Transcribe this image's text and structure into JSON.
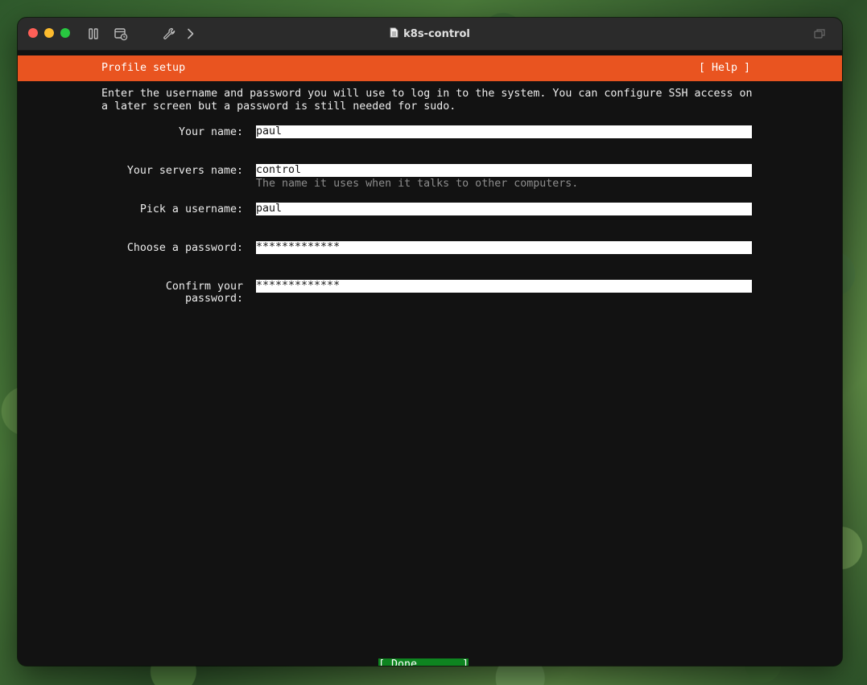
{
  "window": {
    "title": "k8s-control"
  },
  "installer": {
    "header_title": "Profile setup",
    "help_label": "[ Help ]",
    "intro_text": "Enter the username and password you will use to log in to the system. You can configure SSH access on\na later screen but a password is still needed for sudo.",
    "fields": [
      {
        "label": "Your name:",
        "value": "paul"
      },
      {
        "label": "Your servers name:",
        "value": "control",
        "hint": "The name it uses when it talks to other computers."
      },
      {
        "label": "Pick a username:",
        "value": "paul"
      },
      {
        "label": "Choose a password:",
        "value": "*************"
      },
      {
        "label": "Confirm your password:",
        "value": "*************"
      }
    ],
    "done_label": "[ Done       ]"
  },
  "colors": {
    "header": "#e95420",
    "done_button": "#0e8420",
    "terminal_bg": "#121212"
  },
  "icons": {
    "toolbar": [
      "pause-icon",
      "snapshot-icon",
      "wrench-icon",
      "chevron-right-icon",
      "window-restore-icon"
    ],
    "title": "document-icon"
  }
}
